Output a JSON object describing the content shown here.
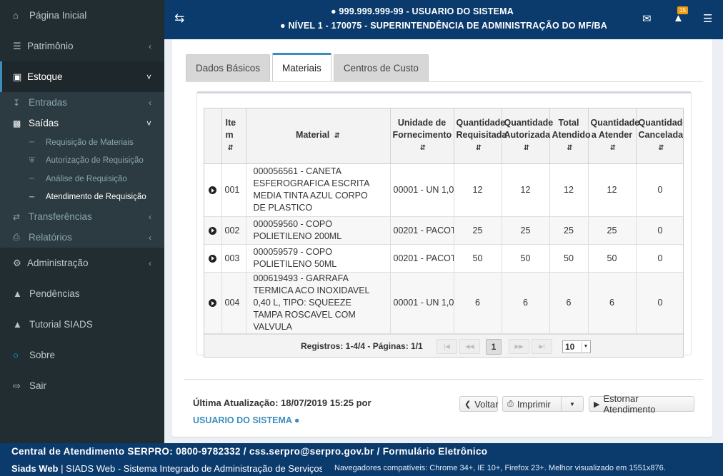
{
  "sidebar": {
    "items": [
      {
        "label": "Página Inicial",
        "icon": "home-icon"
      },
      {
        "label": "Patrimônio",
        "icon": "barcode-icon"
      },
      {
        "label": "Estoque",
        "icon": "box-icon"
      },
      {
        "label": "Entradas",
        "icon": "download-icon"
      },
      {
        "label": "Saídas",
        "icon": "dolly-icon"
      },
      {
        "label": "Requisição de Materiais"
      },
      {
        "label": "Autorização de Requisição"
      },
      {
        "label": "Análise de Requisição"
      },
      {
        "label": "Atendimento de Requisição"
      },
      {
        "label": "Transferências",
        "icon": "exchange-icon"
      },
      {
        "label": "Relatórios",
        "icon": "print-icon"
      },
      {
        "label": "Administração",
        "icon": "gears-icon"
      },
      {
        "label": "Pendências",
        "icon": "warning-icon"
      },
      {
        "label": "Tutorial SIADS",
        "icon": "graduation-cap-icon"
      },
      {
        "label": "Sobre",
        "icon": "circle-icon"
      },
      {
        "label": "Sair",
        "icon": "sign-out-icon"
      }
    ]
  },
  "header": {
    "user_line": "999.999.999-99 - USUARIO DO SISTEMA",
    "level_line": "NÍVEL 1 - 170075 - SUPERINTENDÊNCIA DE ADMINISTRAÇÃO DO MF/BA",
    "badge_count": "15"
  },
  "tabs": [
    {
      "label": "Dados Básicos"
    },
    {
      "label": "Materiais"
    },
    {
      "label": "Centros de Custo"
    }
  ],
  "table": {
    "headers": [
      "Ite m",
      "Material",
      "Unidade de Fornecimento",
      "Quantidade Requisitada",
      "Quantidade Autorizada",
      "Total Atendido",
      "Quantidade a Atender",
      "Quantidade Cancelada"
    ],
    "rows": [
      {
        "item": "001",
        "material": "000056561 - CANETA ESFEROGRAFICA ESCRITA MEDIA TINTA AZUL CORPO DE PLASTICO",
        "unidade": "00001 - UN 1,0",
        "req": "12",
        "aut": "12",
        "atend": "12",
        "a_atender": "12",
        "canc": "0"
      },
      {
        "item": "002",
        "material": "000059560 - COPO POLIETILENO 200ML",
        "unidade": "00201 - PACOT",
        "req": "25",
        "aut": "25",
        "atend": "25",
        "a_atender": "25",
        "canc": "0"
      },
      {
        "item": "003",
        "material": "000059579 - COPO POLIETILENO 50ML",
        "unidade": "00201 - PACOT",
        "req": "50",
        "aut": "50",
        "atend": "50",
        "a_atender": "50",
        "canc": "0"
      },
      {
        "item": "004",
        "material": "000619493 - GARRAFA TERMICA ACO INOXIDAVEL 0,40 L, TIPO: SQUEEZE TAMPA ROSCAVEL COM VALVULA",
        "unidade": "00001 - UN 1,0",
        "req": "6",
        "aut": "6",
        "atend": "6",
        "a_atender": "6",
        "canc": "0"
      }
    ]
  },
  "pager": {
    "records": "Registros: 1-4/4 - Páginas: 1/1",
    "current_page": "1",
    "page_size": "10"
  },
  "footer_info": {
    "last_update": "Última Atualização: 18/07/2019 15:25 por",
    "user": "USUARIO DO SISTEMA"
  },
  "buttons": {
    "back": "Voltar",
    "print": "Imprimir",
    "reverse": "Estornar Atendimento"
  },
  "page_footer": {
    "line1": "Central de Atendimento SERPRO: 0800-9782332 / css.serpro@serpro.gov.br / Formulário Eletrônico",
    "brand": "Siads Web",
    "line2": " | SIADS Web - Sistema Integrado de Administração de Serviços",
    "browsers": "Navegadores compatíveis: Chrome 34+, IE 10+, Firefox 23+. Melhor visualizado em 1551x876."
  }
}
